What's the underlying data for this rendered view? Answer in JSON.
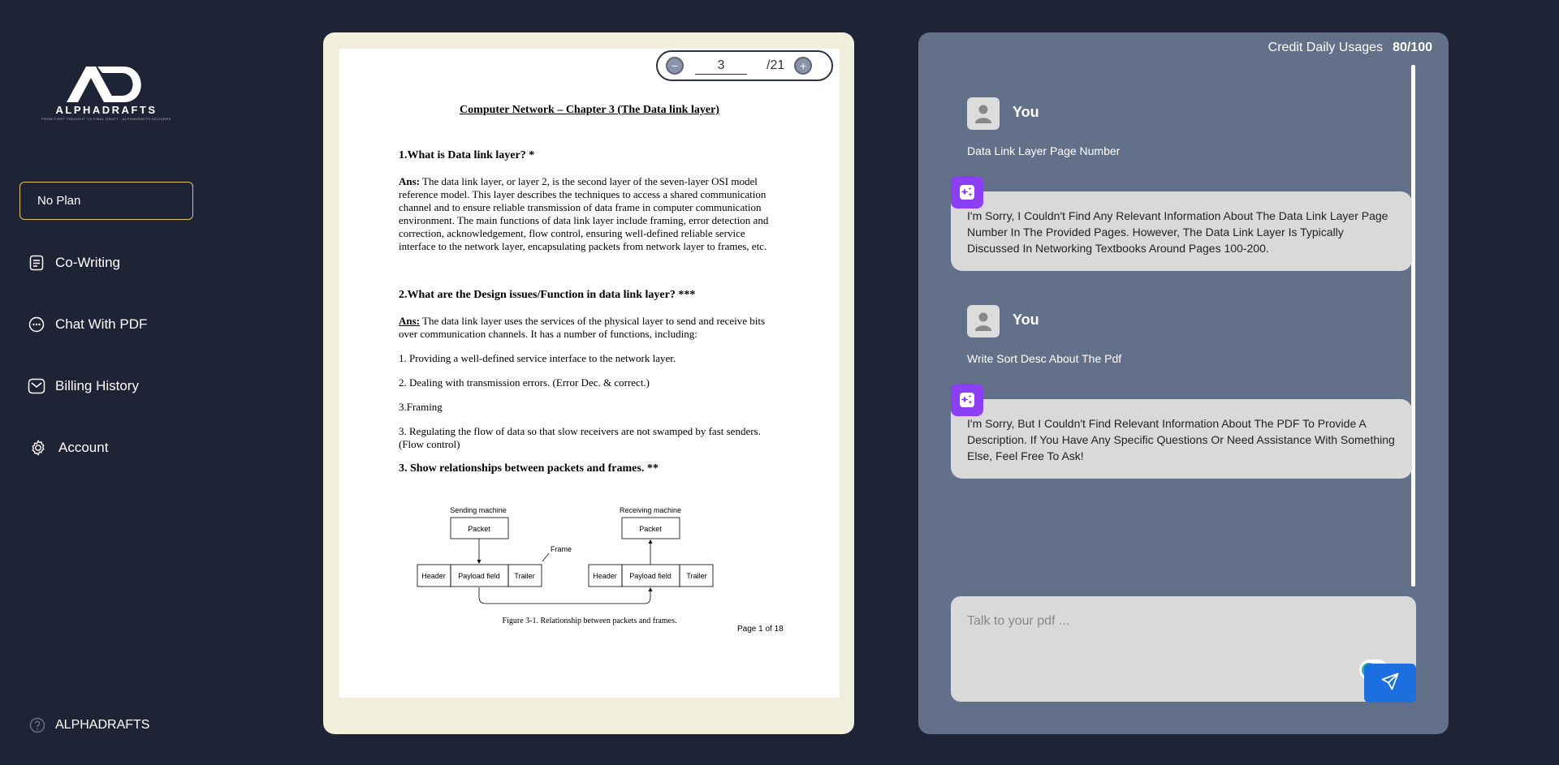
{
  "brand": {
    "logo_mark": "AD",
    "logo_word": "ALPHADRAFTS",
    "logo_tagline": "FROM FIRST THOUGHT TO FINAL DRAFT - ALPHADRAFTS DELIVERS"
  },
  "sidebar": {
    "plan_label": "No Plan",
    "items": [
      {
        "label": "Co-Writing",
        "icon": "document-icon"
      },
      {
        "label": "Chat With PDF",
        "icon": "chat-dots-icon"
      },
      {
        "label": "Billing History",
        "icon": "mail-icon"
      },
      {
        "label": "Account",
        "icon": "gear-icon"
      }
    ],
    "footer_label": "ALPHADRAFTS"
  },
  "pdf_viewer": {
    "current_page": "3",
    "total_pages": "/21",
    "document": {
      "title": "Computer Network – Chapter 3 (The Data link layer)",
      "q1": "1.What is Data link layer? *",
      "a1_label": "Ans:",
      "a1_text": "The data link layer, or layer 2, is the second layer of the seven-layer OSI model reference model. This layer describes the techniques to access a shared communication channel and to ensure reliable transmission of data frame in computer communication environment. The main functions of data link layer include framing, error detection and correction, acknowledgement, flow control, ensuring well-defined reliable service interface to the network layer, encapsulating packets from network layer to frames, etc.",
      "q2": "2.What are the Design issues/Function in data link layer? ***",
      "a2_label": "Ans:",
      "a2_text": "The data link layer uses the services of the physical layer to send and receive bits over communication channels. It has a number of functions, including:",
      "list1": "1. Providing a well-defined service interface to the network layer.",
      "list2": "2. Dealing with transmission errors. (Error Dec. & correct.)",
      "list3": "3.Framing",
      "list4": "3. Regulating the flow of data so that slow receivers are not swamped by fast senders. (Flow control)",
      "q3": "3. Show relationships between packets and frames. **",
      "figure": {
        "sending_machine": "Sending machine",
        "receiving_machine": "Receiving machine",
        "packet": "Packet",
        "frame": "Frame",
        "header": "Header",
        "payload": "Payload field",
        "trailer": "Trailer",
        "caption": "Figure 3-1.  Relationship between packets and frames."
      },
      "page_footer": "Page 1 of 18"
    }
  },
  "chat": {
    "credit_label": "Credit Daily Usages",
    "credit_value": "80/100",
    "messages": [
      {
        "role": "user",
        "name": "You",
        "text": "Data Link Layer Page Number"
      },
      {
        "role": "bot",
        "text": "I'm Sorry, I Couldn't Find Any Relevant Information About The Data Link Layer Page Number In The Provided Pages. However, The Data Link Layer Is Typically Discussed In Networking Textbooks Around Pages 100-200."
      },
      {
        "role": "user",
        "name": "You",
        "text": "Write Sort Desc About The Pdf"
      },
      {
        "role": "bot",
        "text": "I'm Sorry, But I Couldn't Find Relevant Information About The PDF To Provide A Description. If You Have Any Specific Questions Or Need Assistance With Something Else, Feel Free To Ask!"
      }
    ],
    "input_placeholder": "Talk to your pdf ..."
  },
  "colors": {
    "background": "#1e2336",
    "chat_panel": "#637089",
    "pdf_panel": "#f1eedc",
    "plan_border": "#e3c566",
    "bot_icon": "#8b3ff2",
    "send_button": "#1d6fe0"
  }
}
